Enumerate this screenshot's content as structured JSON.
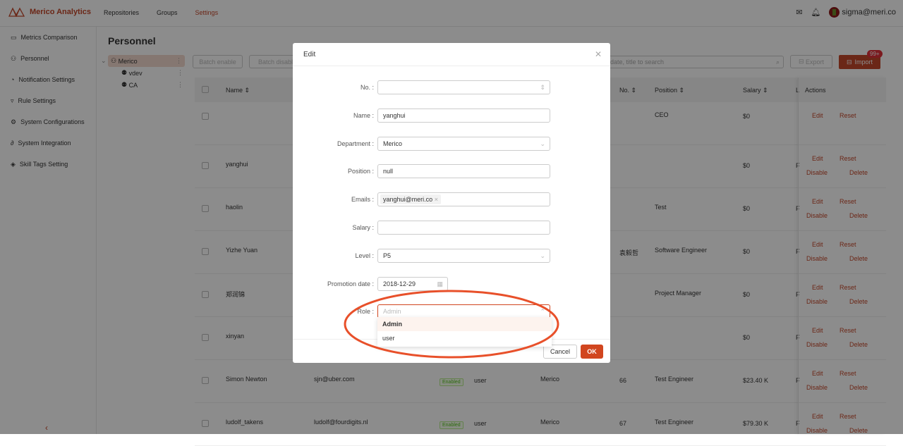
{
  "header": {
    "brand": "Merico Analytics",
    "nav": [
      "Repositories",
      "Groups",
      "Settings"
    ],
    "active_nav": "Settings",
    "user": "sigma@meri.co"
  },
  "sidebar": {
    "items": [
      {
        "label": "Metrics Comparison",
        "icon": "chart-icon"
      },
      {
        "label": "Personnel",
        "icon": "org-icon"
      },
      {
        "label": "Notification Settings",
        "icon": "bell-icon"
      },
      {
        "label": "Rule Settings",
        "icon": "filter-icon"
      },
      {
        "label": "System Configurations",
        "icon": "gear-icon"
      },
      {
        "label": "System Integration",
        "icon": "link-icon"
      },
      {
        "label": "Skill Tags Setting",
        "icon": "tag-icon"
      }
    ]
  },
  "page": {
    "title": "Personnel"
  },
  "tree": {
    "root": "Merico",
    "children": [
      "vdev",
      "CA"
    ]
  },
  "toolbar": {
    "batch_enable": "Batch enable",
    "batch_disable": "Batch disable",
    "search_placeholder": "date, title to search",
    "export": "Export",
    "import": "Import",
    "import_badge": "99+"
  },
  "table": {
    "headers": {
      "name": "Name",
      "no": "No.",
      "position": "Position",
      "salary": "Salary",
      "level": "L",
      "actions": "Actions"
    },
    "rows": [
      {
        "name": "",
        "email": "",
        "status": "",
        "role": "",
        "dept": "",
        "no": "",
        "position": "CEO",
        "salary": "$0",
        "level": "",
        "actions": [
          "Edit",
          "Reset"
        ]
      },
      {
        "name": "yanghui",
        "email": "",
        "status": "",
        "role": "",
        "dept": "",
        "no": "",
        "position": "",
        "salary": "$0",
        "level": "F",
        "actions": [
          "Edit",
          "Reset",
          "Disable",
          "Delete"
        ]
      },
      {
        "name": "haolin",
        "email": "",
        "status": "",
        "role": "",
        "dept": "",
        "no": "",
        "position": "Test",
        "salary": "$0",
        "level": "F",
        "actions": [
          "Edit",
          "Reset",
          "Disable",
          "Delete"
        ]
      },
      {
        "name": "Yizhe Yuan",
        "email": "",
        "status": "",
        "role": "",
        "dept": "",
        "no": "袁毅哲",
        "position": "Software Engineer",
        "salary": "$0",
        "level": "F",
        "actions": [
          "Edit",
          "Reset",
          "Disable",
          "Delete"
        ]
      },
      {
        "name": "郑润锦",
        "email": "",
        "status": "",
        "role": "",
        "dept": "",
        "no": "",
        "position": "Project Manager",
        "salary": "$0",
        "level": "F",
        "actions": [
          "Edit",
          "Reset",
          "Disable",
          "Delete"
        ]
      },
      {
        "name": "xinyan",
        "email": "",
        "status": "",
        "role": "",
        "dept": "",
        "no": "",
        "position": "",
        "salary": "$0",
        "level": "F",
        "actions": [
          "Edit",
          "Reset",
          "Disable",
          "Delete"
        ]
      },
      {
        "name": "Simon Newton",
        "email": "sjn@uber.com",
        "status": "Enabled",
        "role": "user",
        "dept": "Merico",
        "no": "66",
        "position": "Test Engineer",
        "salary": "$23.40 K",
        "level": "F",
        "actions": [
          "Edit",
          "Reset",
          "Disable",
          "Delete"
        ]
      },
      {
        "name": "ludolf_takens",
        "email": "ludolf@fourdigits.nl",
        "status": "Enabled",
        "role": "user",
        "dept": "Merico",
        "no": "67",
        "position": "Test Engineer",
        "salary": "$79.30 K",
        "level": "F",
        "actions": [
          "Edit",
          "Reset",
          "Disable",
          "Delete"
        ]
      }
    ]
  },
  "modal": {
    "title": "Edit",
    "fields": [
      {
        "label": "No.",
        "value": "",
        "type": "number"
      },
      {
        "label": "Name",
        "value": "yanghui",
        "type": "text"
      },
      {
        "label": "Department",
        "value": "Merico",
        "type": "select"
      },
      {
        "label": "Position",
        "value": "null",
        "type": "text"
      },
      {
        "label": "Emails",
        "value": "yanghui@meri.co",
        "type": "tags"
      },
      {
        "label": "Salary",
        "value": "",
        "type": "text"
      },
      {
        "label": "Level",
        "value": "P5",
        "type": "select"
      },
      {
        "label": "Promotion date",
        "value": "2018-12-29",
        "type": "date"
      },
      {
        "label": "Role",
        "placeholder": "Admin",
        "type": "select-open"
      }
    ],
    "role_options": [
      "Admin",
      "user"
    ],
    "highlighted_option": "Admin",
    "cancel": "Cancel",
    "ok": "OK"
  },
  "colors": {
    "accent": "#c4472a",
    "annotation": "#e8502a"
  }
}
